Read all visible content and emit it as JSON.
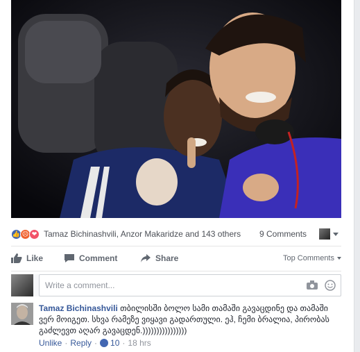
{
  "post": {
    "reactions_summary": "Tamaz Bichinashvili, Anzor Makaridze and 143 others",
    "comments_count": "9 Comments",
    "reaction_icons": [
      "like-icon",
      "angry-icon",
      "love-icon"
    ]
  },
  "actions": {
    "like_label": "Like",
    "comment_label": "Comment",
    "share_label": "Share",
    "sort_label": "Top Comments"
  },
  "composer": {
    "placeholder": "Write a comment..."
  },
  "comments": [
    {
      "author": "Tamaz Bichinashvili",
      "text": "თბილისში ბოლო სამი თამაში გავაცდინე და თამაში ვერ მოიგეთ. სხვა რამეზე ვიყავი გადართული. ეჰ, ჩემი ბრალია, პირობას გაძლევთ აღარ გავაცდენ.))))))))))))))))",
      "unlike_label": "Unlike",
      "reply_label": "Reply",
      "likes": "10",
      "time": "18 hrs"
    }
  ],
  "colors": {
    "link": "#365899",
    "brand_blue": "#4267b2",
    "muted": "#90949c"
  }
}
